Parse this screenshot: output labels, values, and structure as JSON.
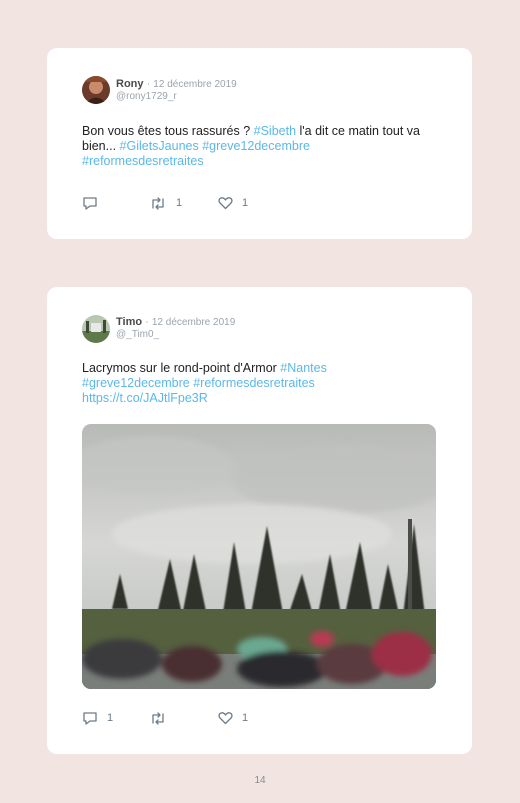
{
  "page": {
    "number": "14"
  },
  "tweets": [
    {
      "author": "Rony",
      "separator": "·",
      "date": "12 décembre 2019",
      "handle": "@rony1729_r",
      "text_parts": [
        "Bon vous êtes tous rassurés ? ",
        "#Sibeth",
        " l'a dit ce matin tout va bien... ",
        "#GiletsJaunes",
        " ",
        "#greve12decembre",
        " ",
        "#reformesdesretraites"
      ],
      "reply_count": "",
      "retweet_count": "1",
      "like_count": "1",
      "icons": [
        "reply-icon",
        "retweet-icon",
        "heart-icon"
      ]
    },
    {
      "author": "Timo",
      "separator": "·",
      "date": "12 décembre 2019",
      "handle": "@_Tim0_",
      "text_parts": [
        "Lacrymos sur le rond-point d'Armor ",
        "#Nantes",
        "#greve12decembre",
        " ",
        "#reformesdesretraites",
        "https://t.co/JAJtlFpe3R"
      ],
      "reply_count": "1",
      "retweet_count": "",
      "like_count": "1",
      "icons": [
        "reply-icon",
        "retweet-icon",
        "heart-icon"
      ]
    }
  ],
  "colors": {
    "background": "#f2e4e1",
    "card": "#ffffff",
    "link": "#5bb8e8",
    "meta": "#9aa4ad"
  }
}
